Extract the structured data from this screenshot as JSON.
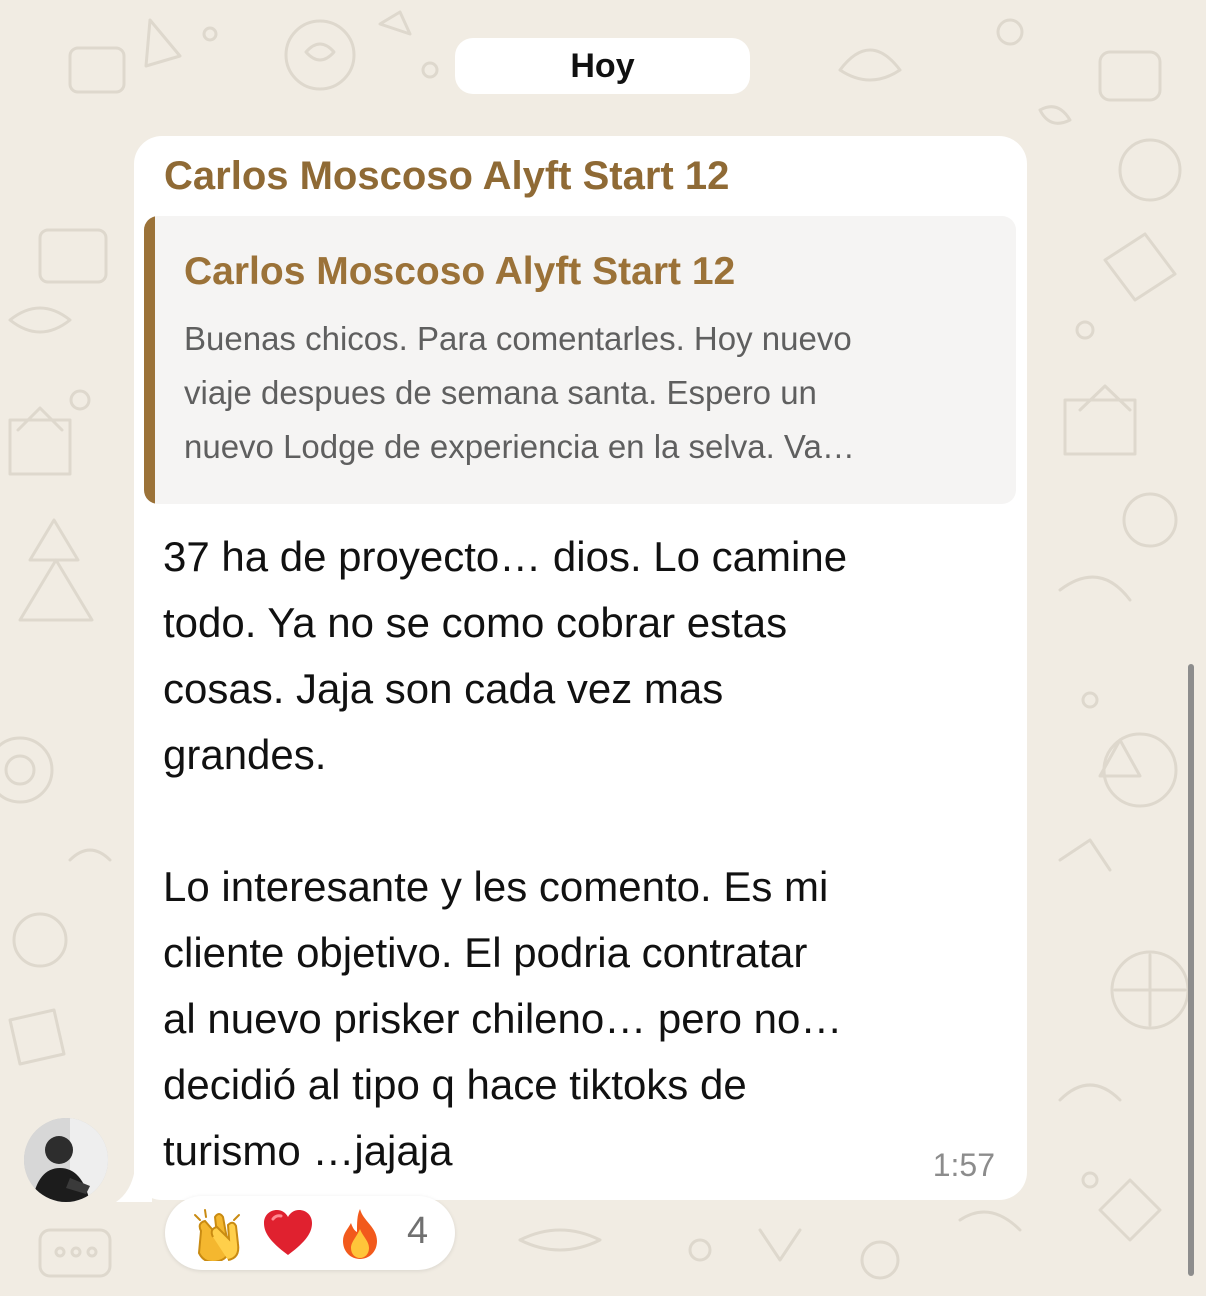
{
  "chat": {
    "date_separator": "Hoy"
  },
  "message": {
    "sender": "Carlos Moscoso Alyft Start 12",
    "reply": {
      "author": "Carlos Moscoso Alyft Start 12",
      "lines": [
        "Buenas chicos. Para comentarles. Hoy nuevo",
        "viaje despues de semana santa. Espero un",
        "nuevo Lodge de experiencia en la selva. Va…"
      ]
    },
    "lines": [
      "37 ha de proyecto… dios. Lo camine",
      "todo. Ya no se como cobrar estas",
      "cosas. Jaja son cada vez mas",
      "grandes.",
      "",
      "Lo interesante y les comento. Es mi",
      "cliente objetivo. El podria contratar",
      "al nuevo prisker chileno… pero no…",
      "decidió al tipo q hace tiktoks de",
      "turismo …jajaja"
    ],
    "time": "1:57",
    "reactions": {
      "icons": [
        "clapping-hands-icon",
        "red-heart-icon",
        "fire-icon"
      ],
      "count": "4"
    }
  },
  "colors": {
    "wallpaper": "#f1ece3",
    "sender_name": "#8f6a35",
    "quote_bar": "#9b7238",
    "bubble": "#ffffff"
  }
}
